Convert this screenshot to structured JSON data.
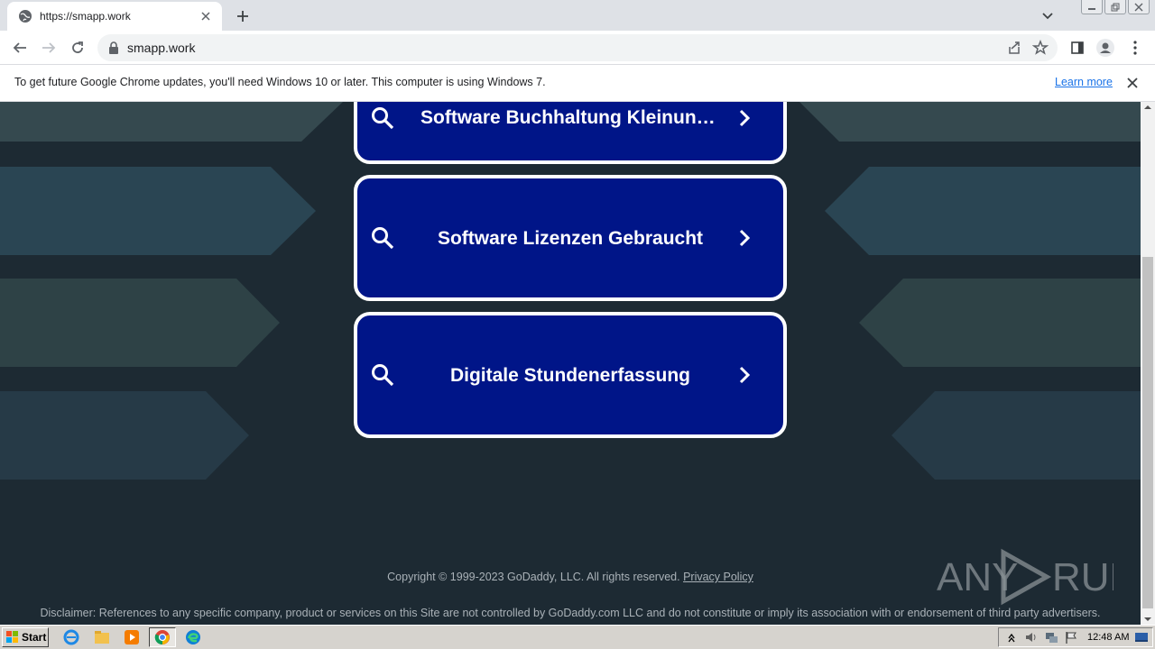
{
  "browser": {
    "tab_title": "https://smapp.work",
    "url": "smapp.work"
  },
  "infobar": {
    "message": "To get future Google Chrome updates, you'll need Windows 10 or later. This computer is using Windows 7.",
    "learn_more": "Learn more"
  },
  "page": {
    "cards": [
      {
        "label": "Software Buchhaltung Kleinunter..."
      },
      {
        "label": "Software Lizenzen Gebraucht"
      },
      {
        "label": "Digitale Stundenerfassung"
      }
    ],
    "copyright": "Copyright © 1999-2023 GoDaddy, LLC. All rights reserved.",
    "privacy_policy": "Privacy Policy",
    "disclaimer": "Disclaimer: References to any specific company, product or services on this Site are not controlled by GoDaddy.com LLC and do not constitute or imply its association with or endorsement of third party advertisers.",
    "watermark": "ANY RUN"
  },
  "taskbar": {
    "start_label": "Start",
    "clock": "12:48 AM"
  },
  "colors": {
    "page_bg": "#1d2a33",
    "card_bg": "#001588",
    "card_border": "#ffffff",
    "link_blue": "#1a73e8"
  }
}
